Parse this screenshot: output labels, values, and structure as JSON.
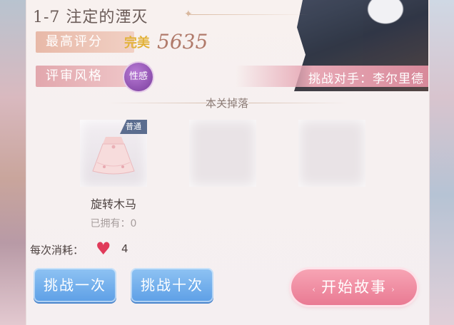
{
  "stage": {
    "title": "1-7 注定的湮灭"
  },
  "score": {
    "label": "最高评分",
    "rating": "完美",
    "value": "5635"
  },
  "style": {
    "label": "评审风格",
    "value": "性感"
  },
  "opponent": {
    "text": "挑战对手：李尔里德"
  },
  "drops": {
    "title": "本关掉落",
    "items": [
      {
        "name": "旋转木马",
        "owned": "已拥有：0",
        "quality": "普通"
      },
      {
        "name": "",
        "owned": "",
        "quality": ""
      },
      {
        "name": "",
        "owned": "",
        "quality": ""
      }
    ]
  },
  "cost": {
    "label": "每次消耗：",
    "value": "4",
    "icon": "heart-icon"
  },
  "buttons": {
    "once": "挑战一次",
    "ten": "挑战十次",
    "start": "开始故事"
  },
  "colors": {
    "accent_pink": "#e97a93",
    "button_blue": "#5d9fe6",
    "perfect_gold": "#e2b23a",
    "heart_red": "#e03b5a"
  }
}
